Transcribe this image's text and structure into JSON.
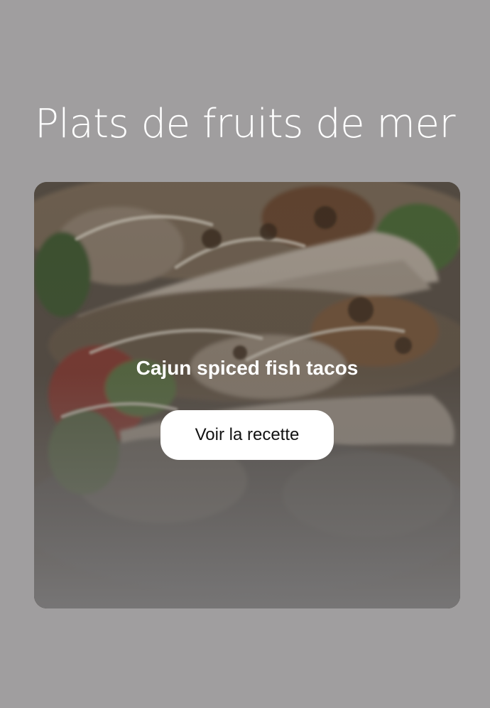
{
  "section": {
    "title": "Plats de fruits de mer"
  },
  "card": {
    "image_subject": "fish-tacos-photo",
    "recipe_name": "Cajun spiced fish tacos",
    "button_label": "Voir la recette"
  },
  "colors": {
    "page_background": "#a09e9f",
    "title_text": "#ffffff",
    "button_background": "#ffffff",
    "button_text": "#111111"
  }
}
